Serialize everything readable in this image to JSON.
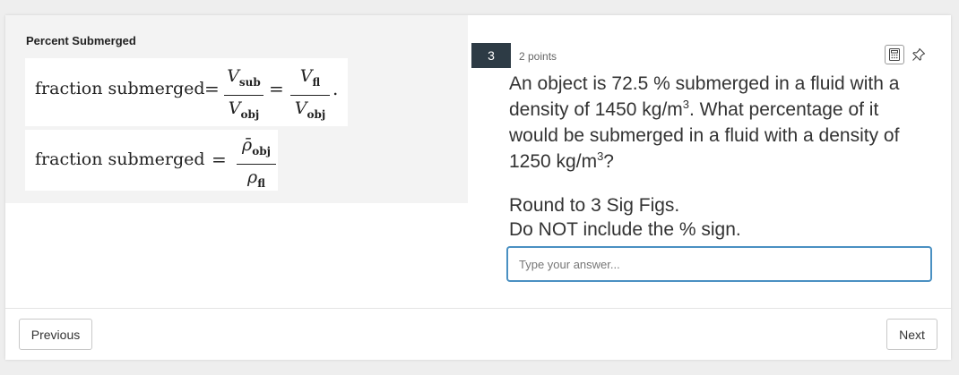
{
  "reference": {
    "title": "Percent Submerged",
    "formula1": {
      "label": "fraction submerged",
      "equals": "=",
      "frac1_num": "V",
      "frac1_num_sub": "sub",
      "frac1_den": "V",
      "frac1_den_sub": "obj",
      "frac2_num": "V",
      "frac2_num_sub": "fl",
      "frac2_den": "V",
      "frac2_den_sub": "obj",
      "period": "."
    },
    "formula2": {
      "label": "fraction submerged",
      "equals": "=",
      "num": "ρ̄",
      "num_sub": "obj",
      "den": "ρ",
      "den_sub": "fl"
    }
  },
  "question": {
    "number": "3",
    "points": "2 points",
    "text_1": "An object is 72.5 % submerged in a fluid with a density of 1450 kg/m",
    "sup_1": "3",
    "text_2": ".  What percentage of it would be submerged in a fluid with a density of 1250 kg/m",
    "sup_2": "3",
    "text_3": "?",
    "instruction_1": "Round to 3 Sig Figs.",
    "instruction_2": "Do NOT include the % sign.",
    "answer_value": "",
    "answer_placeholder": "Type your answer..."
  },
  "icons": {
    "calculator": "calculator-icon",
    "pin": "pin-icon"
  },
  "navigation": {
    "previous_label": "Previous",
    "next_label": "Next"
  }
}
